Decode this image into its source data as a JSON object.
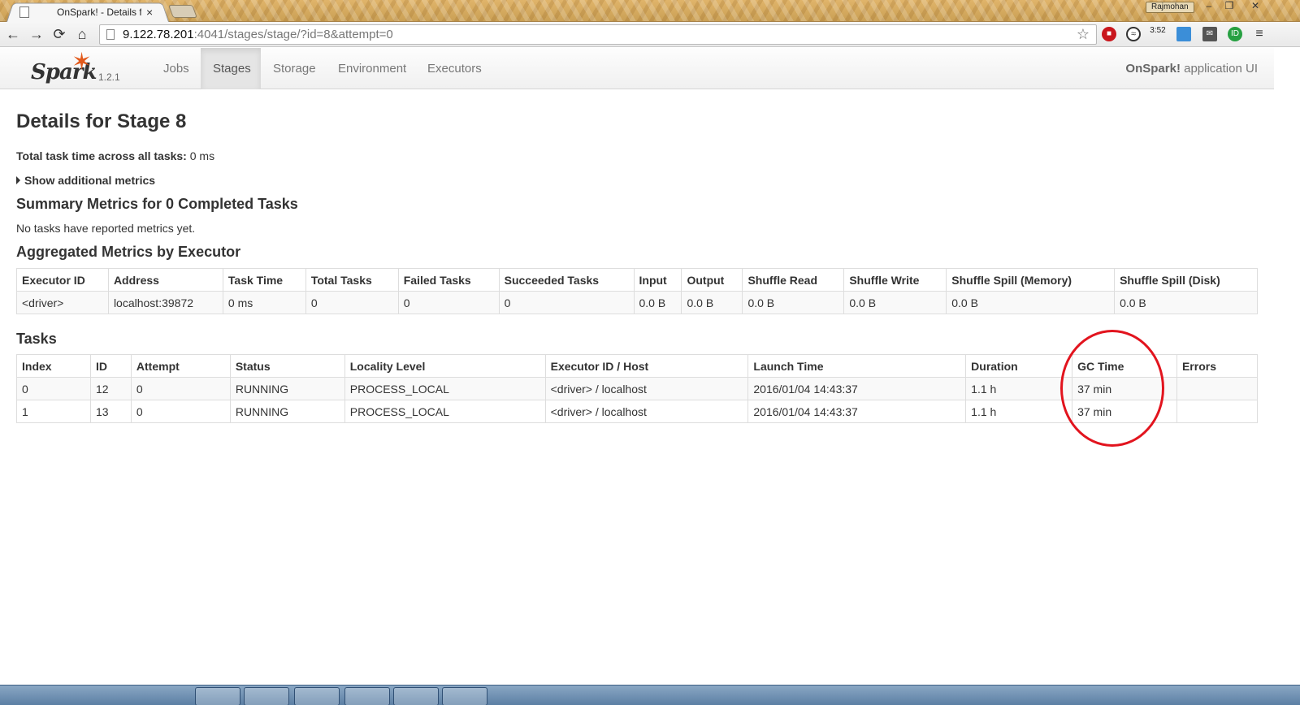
{
  "browser": {
    "tab_title": "OnSpark! - Details f",
    "tab_close": "×",
    "user_name": "Rajmohan",
    "win_min": "–",
    "win_max": "❐",
    "win_close": "✕",
    "url_host": "9.122.78.201",
    "url_path": ":4041/stages/stage/?id=8&attempt=0",
    "back_glyph": "←",
    "forward_glyph": "→",
    "reload_glyph": "⟳",
    "home_glyph": "⌂",
    "star_glyph": "☆",
    "menu_glyph": "≡",
    "ext_clock_label": "3:52",
    "ext_id_label": "ID"
  },
  "spark": {
    "brand": "Spark",
    "version": "1.2.1",
    "nav": {
      "jobs": "Jobs",
      "stages": "Stages",
      "storage": "Storage",
      "environment": "Environment",
      "executors": "Executors"
    },
    "app_name": "OnSpark!",
    "app_suffix": " application UI",
    "active_tab": "Stages"
  },
  "page": {
    "title": "Details for Stage 8",
    "total_label": "Total task time across all tasks:",
    "total_value": " 0 ms",
    "additional_metrics": "Show additional metrics",
    "summary_heading": "Summary Metrics for 0 Completed Tasks",
    "no_tasks": "No tasks have reported metrics yet.",
    "agg_heading": "Aggregated Metrics by Executor",
    "tasks_heading": "Tasks"
  },
  "agg_table": {
    "headers": [
      "Executor ID",
      "Address",
      "Task Time",
      "Total Tasks",
      "Failed Tasks",
      "Succeeded Tasks",
      "Input",
      "Output",
      "Shuffle Read",
      "Shuffle Write",
      "Shuffle Spill (Memory)",
      "Shuffle Spill (Disk)"
    ],
    "rows": [
      [
        "<driver>",
        "localhost:39872",
        "0 ms",
        "0",
        "0",
        "0",
        "0.0 B",
        "0.0 B",
        "0.0 B",
        "0.0 B",
        "0.0 B",
        "0.0 B"
      ]
    ]
  },
  "tasks_table": {
    "headers": [
      "Index",
      "ID",
      "Attempt",
      "Status",
      "Locality Level",
      "Executor ID / Host",
      "Launch Time",
      "Duration",
      "GC Time",
      "Errors"
    ],
    "rows": [
      [
        "0",
        "12",
        "0",
        "RUNNING",
        "PROCESS_LOCAL",
        "<driver> / localhost",
        "2016/01/04 14:43:37",
        "1.1 h",
        "37 min",
        ""
      ],
      [
        "1",
        "13",
        "0",
        "RUNNING",
        "PROCESS_LOCAL",
        "<driver> / localhost",
        "2016/01/04 14:43:37",
        "1.1 h",
        "37 min",
        ""
      ]
    ]
  },
  "colors": {
    "spark_orange": "#e25a1c",
    "annotation_red": "#e2141e"
  }
}
